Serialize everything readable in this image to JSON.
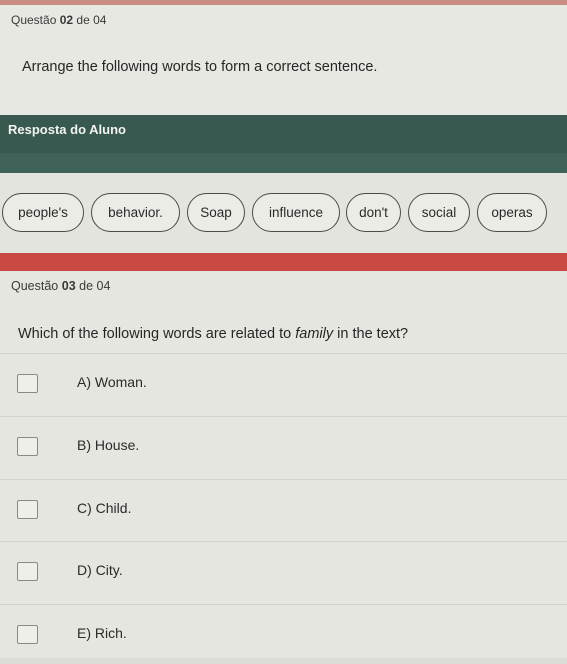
{
  "question2": {
    "header_prefix": "Questão",
    "number": "02",
    "header_suffix": "de 04",
    "prompt": "Arrange the following words to form a correct sentence."
  },
  "response": {
    "title": "Resposta do Aluno"
  },
  "words": [
    "people's",
    "behavior.",
    "Soap",
    "influence",
    "don't",
    "social",
    "operas"
  ],
  "question3": {
    "header_prefix": "Questão",
    "number": "03",
    "header_suffix": "de 04",
    "prompt_before": "Which of the following words are related to",
    "prompt_italic": "family",
    "prompt_after": "in the text?",
    "options": [
      "A) Woman.",
      "B) House.",
      "C) Child.",
      "D) City.",
      "E) Rich."
    ]
  },
  "colors": {
    "accent_red": "#c94a42",
    "response_bar": "#37594f"
  }
}
